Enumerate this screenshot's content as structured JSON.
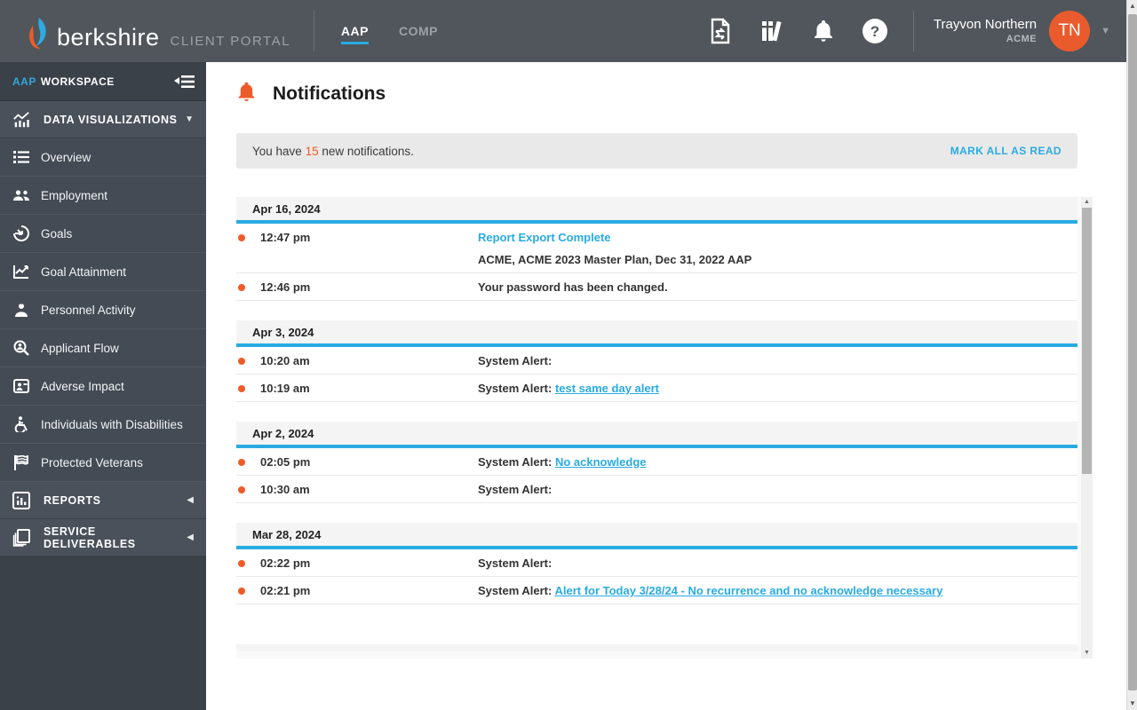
{
  "header": {
    "brand": "berkshire",
    "portal_label": "CLIENT PORTAL",
    "tabs": {
      "aap": "AAP",
      "comp": "COMP"
    },
    "icons": [
      "report-export-icon",
      "library-icon",
      "notifications-bell-icon",
      "help-icon"
    ],
    "user": {
      "name": "Trayvon Northern",
      "org": "ACME",
      "initials": "TN"
    }
  },
  "sidebar": {
    "workspace_prefix": "AAP",
    "workspace_label": "WORKSPACE",
    "data_viz_label": "DATA VISUALIZATIONS",
    "items": [
      {
        "label": "Overview",
        "icon": "list-icon"
      },
      {
        "label": "Employment",
        "icon": "people-icon"
      },
      {
        "label": "Goals",
        "icon": "goal-arrow-icon"
      },
      {
        "label": "Goal Attainment",
        "icon": "chart-line-icon"
      },
      {
        "label": "Personnel Activity",
        "icon": "person-star-icon"
      },
      {
        "label": "Applicant Flow",
        "icon": "person-search-icon"
      },
      {
        "label": "Adverse Impact",
        "icon": "person-card-icon"
      },
      {
        "label": "Individuals with Disabilities",
        "icon": "wheelchair-icon"
      },
      {
        "label": "Protected Veterans",
        "icon": "flag-icon"
      }
    ],
    "reports_label": "REPORTS",
    "service_deliverables_label": "SERVICE DELIVERABLES"
  },
  "main": {
    "title": "Notifications",
    "banner": {
      "pre": "You have ",
      "count": "15",
      "post": " new notifications.",
      "action": "MARK ALL AS READ"
    },
    "groups": [
      {
        "date": "Apr 16, 2024",
        "items": [
          {
            "time": "12:47 pm",
            "title_link": "Report Export Complete",
            "subtitle": "ACME, ACME 2023 Master Plan, Dec 31, 2022 AAP"
          },
          {
            "time": "12:46 pm",
            "text": "Your password has been changed."
          }
        ]
      },
      {
        "date": "Apr 3, 2024",
        "items": [
          {
            "time": "10:20 am",
            "text": "System Alert:"
          },
          {
            "time": "10:19 am",
            "text": "System Alert: ",
            "link": "test same day alert"
          }
        ]
      },
      {
        "date": "Apr 2, 2024",
        "items": [
          {
            "time": "02:05 pm",
            "text": "System Alert: ",
            "link": "No acknowledge"
          },
          {
            "time": "10:30 am",
            "text": "System Alert:"
          }
        ]
      },
      {
        "date": "Mar 28, 2024",
        "items": [
          {
            "time": "02:22 pm",
            "text": "System Alert:"
          },
          {
            "time": "02:21 pm",
            "text": "System Alert: ",
            "link": "Alert for Today 3/28/24 - No recurrence and no acknowledge necessary"
          }
        ]
      }
    ]
  },
  "colors": {
    "accent_cyan": "#29abe2",
    "accent_orange": "#ee5b2b",
    "header_bg": "#50565c",
    "sidebar_bg": "#3b4149"
  }
}
